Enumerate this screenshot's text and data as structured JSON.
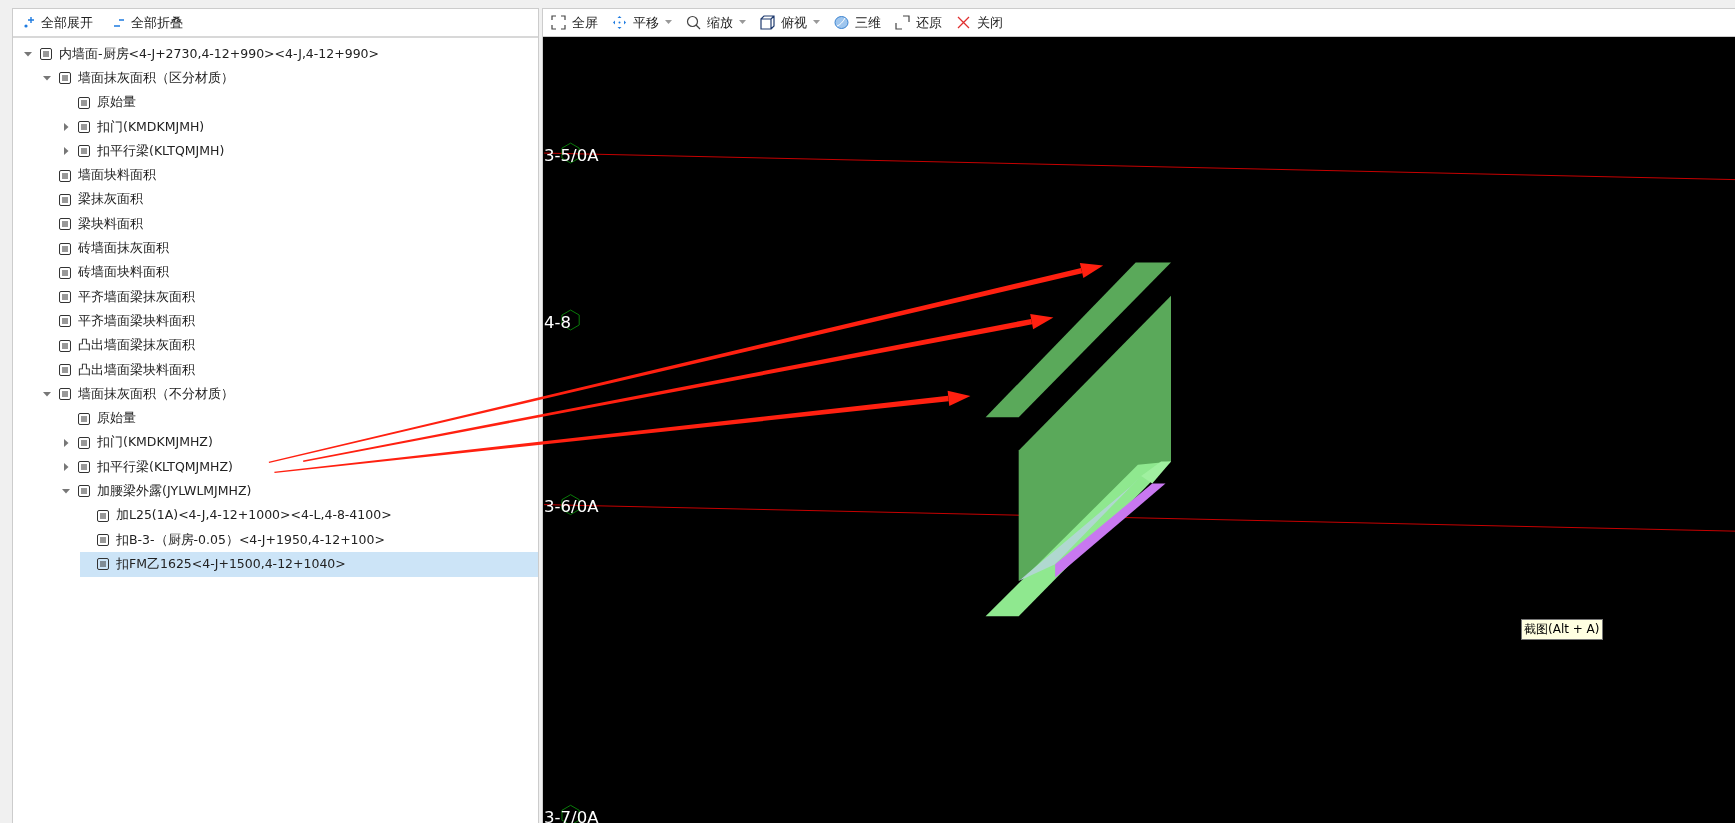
{
  "tree_toolbar": [
    {
      "label": "全部展开"
    },
    {
      "label": "全部折叠"
    }
  ],
  "tree": [
    {
      "kind": "group",
      "label": "内墙面-厨房<4-J+2730,4-12+990><4-J,4-12+990>",
      "expanded": true,
      "selected": false,
      "children": [
        {
          "kind": "group",
          "label": "墙面抹灰面积（区分材质）",
          "expanded": true,
          "selected": false,
          "children": [
            {
              "kind": "leaf",
              "label": "原始量",
              "selected": false
            },
            {
              "kind": "group",
              "label": "扣门(KMDKMJMH)",
              "expanded": false,
              "selected": false
            },
            {
              "kind": "group",
              "label": "扣平行梁(KLTQMJMH)",
              "expanded": false,
              "selected": false
            }
          ]
        },
        {
          "kind": "leaf",
          "label": "墙面块料面积",
          "selected": false
        },
        {
          "kind": "leaf",
          "label": "梁抹灰面积",
          "selected": false
        },
        {
          "kind": "leaf",
          "label": "梁块料面积",
          "selected": false
        },
        {
          "kind": "leaf",
          "label": "砖墙面抹灰面积",
          "selected": false
        },
        {
          "kind": "leaf",
          "label": "砖墙面块料面积",
          "selected": false
        },
        {
          "kind": "leaf",
          "label": "平齐墙面梁抹灰面积",
          "selected": false
        },
        {
          "kind": "leaf",
          "label": "平齐墙面梁块料面积",
          "selected": false
        },
        {
          "kind": "leaf",
          "label": "凸出墙面梁抹灰面积",
          "selected": false
        },
        {
          "kind": "leaf",
          "label": "凸出墙面梁块料面积",
          "selected": false
        },
        {
          "kind": "group",
          "label": "墙面抹灰面积（不分材质）",
          "expanded": true,
          "selected": false,
          "children": [
            {
              "kind": "leaf",
              "label": "原始量",
              "selected": false
            },
            {
              "kind": "group",
              "label": "扣门(KMDKMJMHZ)",
              "expanded": false,
              "selected": false
            },
            {
              "kind": "group",
              "label": "扣平行梁(KLTQMJMHZ)",
              "expanded": false,
              "selected": false
            },
            {
              "kind": "group",
              "label": "加腰梁外露(JYLWLMJMHZ)",
              "expanded": true,
              "selected": false,
              "children": [
                {
                  "kind": "leaf",
                  "label": "加L25(1A)<4-J,4-12+1000><4-L,4-8-4100>",
                  "selected": false
                },
                {
                  "kind": "leaf",
                  "label": "扣B-3-（厨房-0.05）<4-J+1950,4-12+100>",
                  "selected": false
                },
                {
                  "kind": "leaf",
                  "label": "扣FM乙1625<4-J+1500,4-12+1040>",
                  "selected": true
                }
              ]
            }
          ]
        }
      ]
    }
  ],
  "view_toolbar": [
    {
      "label": "全屏",
      "has_menu": false
    },
    {
      "label": "平移",
      "has_menu": true
    },
    {
      "label": "缩放",
      "has_menu": true
    },
    {
      "label": "俯视",
      "has_menu": true
    },
    {
      "label": "三维",
      "has_menu": false
    },
    {
      "label": "还原",
      "has_menu": false
    },
    {
      "label": "关闭",
      "has_menu": false
    }
  ],
  "axis_labels": [
    "3-5/0A",
    "4-8",
    "3-6/0A",
    "3-7/0A"
  ],
  "tooltip": "截图(Alt + A)"
}
